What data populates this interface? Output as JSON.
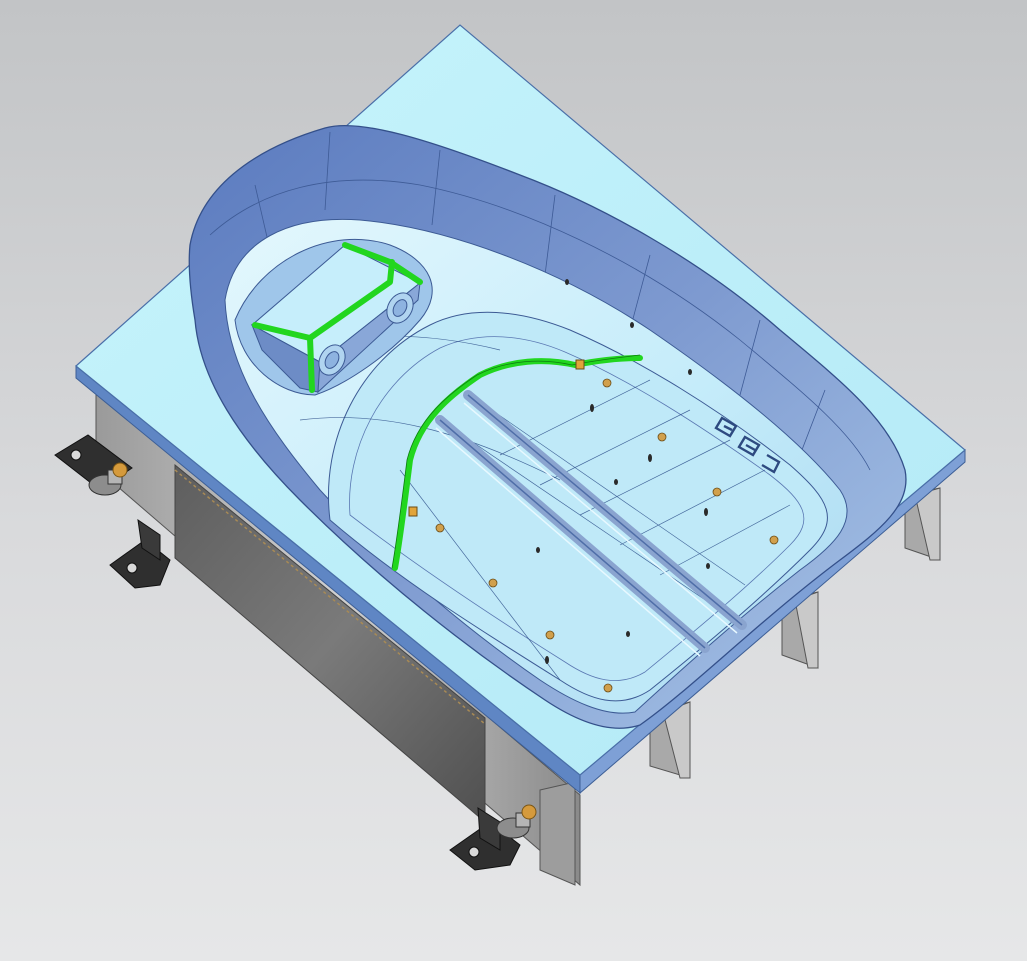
{
  "scene": {
    "view": "isometric",
    "background": {
      "top": "#c2c4c6",
      "bottom": "#e6e7e8"
    },
    "colors": {
      "plate_top": "#bff0fa",
      "plate_edge": "#5f86c4",
      "cavity_wall": "#6b89c4",
      "cavity_floor": "#c2ecfa",
      "accent_edge": "#22d61f",
      "frame_metal": "#b9b9b9",
      "frame_dark": "#6e6e6e",
      "bracket": "#2f2f2f",
      "nut": "#d59a3c"
    },
    "objects": [
      "mold-plate",
      "seat-cavity",
      "headrest-pocket",
      "inner-rail-left",
      "inner-rail-right",
      "green-trim-edge",
      "engraved-marking",
      "support-frame",
      "mounting-bracket",
      "adjust-knob"
    ]
  }
}
